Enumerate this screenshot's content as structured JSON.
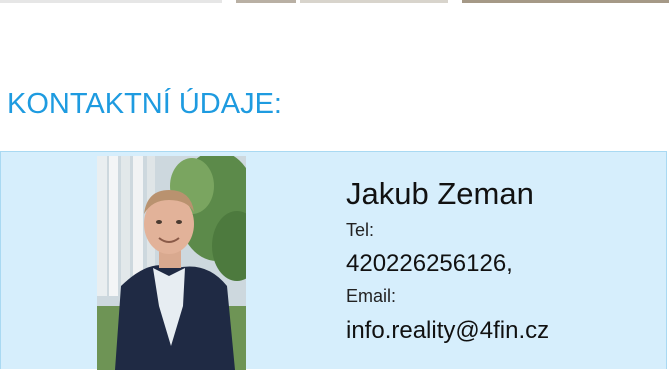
{
  "section": {
    "title": "KONTAKTNÍ ÚDAJE:"
  },
  "contact": {
    "name": "Jakub Zeman",
    "phone_label": "Tel:",
    "phone_value": "420226256126,",
    "email_label": "Email:",
    "email_value": "info.reality@4fin.cz"
  },
  "colors": {
    "accent": "#1e9be0",
    "card_background": "#d6eefc",
    "card_border": "#a9d9f2"
  },
  "icons": {
    "photo": "agent-portrait-photo"
  }
}
